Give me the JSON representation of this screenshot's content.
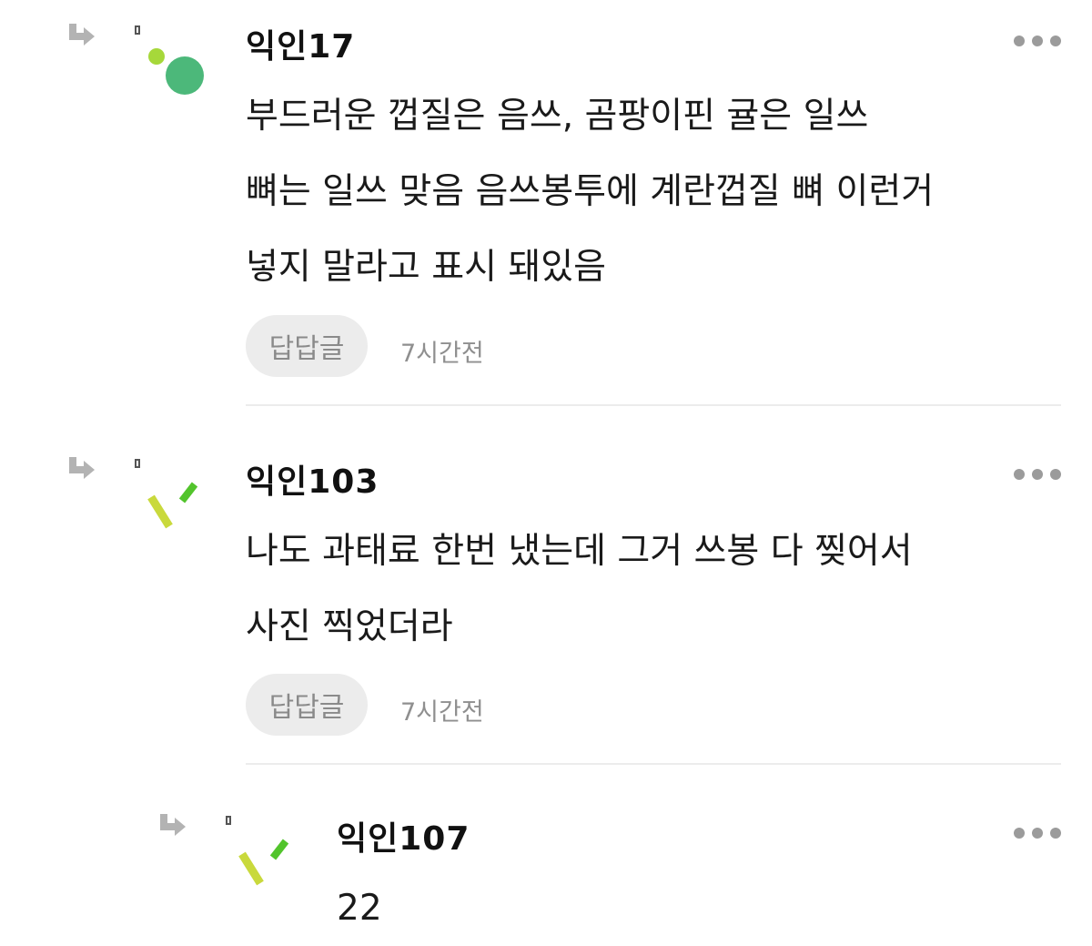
{
  "comments": [
    {
      "author": "익인17",
      "lines": [
        "부드러운 껍질은 음쓰, 곰팡이핀 귤은 일쓰",
        "뼈는 일쓰 맞음 음쓰봉투에 계란껍질 뼈 이런거",
        "넣지 말라고 표시 돼있음"
      ],
      "reply_label": "답답글",
      "time": "7시간전",
      "avatar_icon": "dots-avatar-icon"
    },
    {
      "author": "익인103",
      "lines": [
        "나도 과태료 한번 냈는데 그거 쓰봉 다 찢어서",
        "사진 찍었더라"
      ],
      "reply_label": "답답글",
      "time": "7시간전",
      "avatar_icon": "sticks-avatar-icon"
    },
    {
      "author": "익인107",
      "lines": [
        "22"
      ],
      "avatar_icon": "sticks-avatar-icon"
    }
  ],
  "colors": {
    "avatar_green_dark": "#4cb87a",
    "avatar_green_light": "#a6d83a",
    "stick_yellow": "#c9d93c",
    "stick_green": "#52c42c",
    "reply_button_bg": "#ececec",
    "more_dots": "#9b9b9b"
  }
}
